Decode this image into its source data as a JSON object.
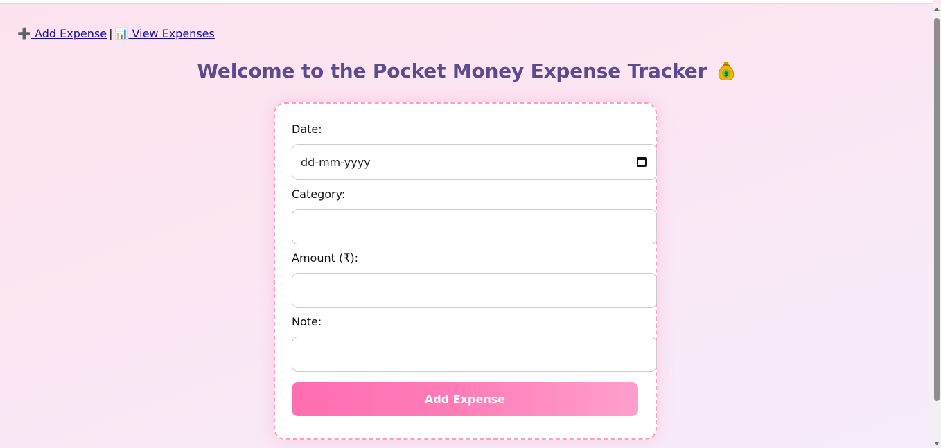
{
  "nav": {
    "add_icon": "➕",
    "add_label": "Add Expense",
    "separator": "|",
    "view_icon": "📊",
    "view_label": "View Expenses"
  },
  "page": {
    "title": "Welcome to the Pocket Money Expense Tracker",
    "title_icon": "money-bag-icon"
  },
  "form": {
    "date_label": "Date:",
    "date_placeholder": "dd-mm-yyyy",
    "category_label": "Category:",
    "category_value": "",
    "amount_label": "Amount (₹):",
    "amount_value": "",
    "note_label": "Note:",
    "note_value": "",
    "submit_label": "Add Expense"
  },
  "colors": {
    "title": "#5e4a8e",
    "card_border": "#ff9cc4",
    "button_start": "#ff6fb1",
    "button_end": "#ff9fcc",
    "link": "#1a0dab"
  }
}
